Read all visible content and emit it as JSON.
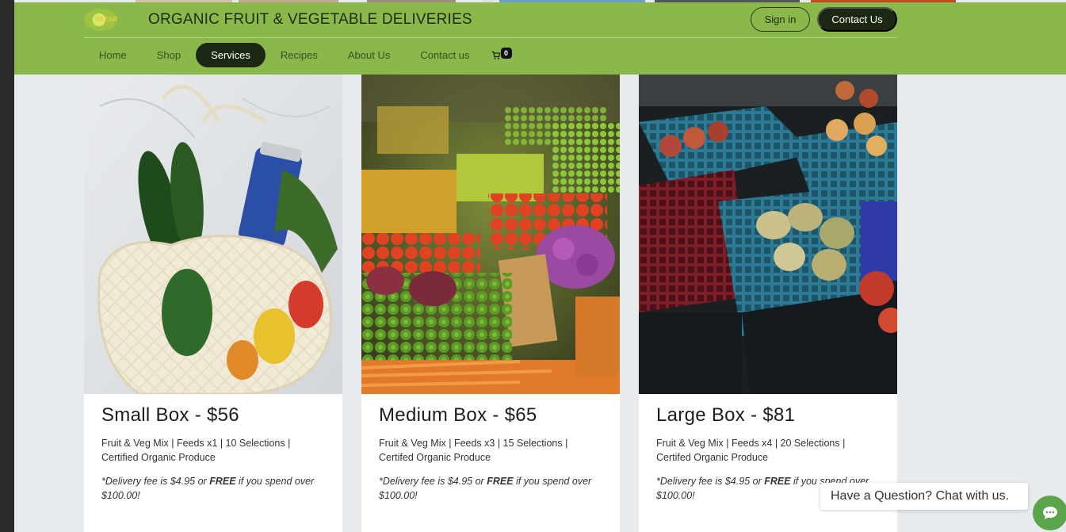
{
  "header": {
    "logo_text": "BAZAR",
    "site_title": "ORGANIC FRUIT & VEGETABLE DELIVERIES",
    "signin_label": "Sign in",
    "contact_label": "Contact Us"
  },
  "nav": {
    "items": [
      {
        "label": "Home"
      },
      {
        "label": "Shop"
      },
      {
        "label": "Services"
      },
      {
        "label": "Recipes"
      },
      {
        "label": "About Us"
      },
      {
        "label": "Contact us"
      }
    ],
    "active": "Services",
    "cart_count": "0"
  },
  "cards": [
    {
      "title": "Small Box - $56",
      "desc": "Fruit & Veg Mix | Feeds x1 | 10 Selections | Certified Organic Produce",
      "note_pre": "*Delivery fee is $4.95 or ",
      "note_bold": "FREE",
      "note_post": " if you spend over $100.00!"
    },
    {
      "title": "Medium Box - $65",
      "desc": "Fruit & Veg Mix | Feeds x3 | 15 Selections | Certifed Organic Produce",
      "note_pre": "*Delivery fee is $4.95 or ",
      "note_bold": "FREE",
      "note_post": " if you spend over $100.00!"
    },
    {
      "title": "Large Box - $81",
      "desc": "Fruit & Veg Mix | Feeds x4 | 20 Selections | Certifed Organic Produce",
      "note_pre": "*Delivery fee is $4.95 or ",
      "note_bold": "FREE",
      "note_post": " if you spend over $100.00!"
    }
  ],
  "chat": {
    "prompt": "Have a Question? Chat with us."
  },
  "colors": {
    "header_green": "#8ab84a",
    "dark_button": "#1d2814",
    "chat_green": "#5aa54a"
  },
  "icons": [
    "cart-icon",
    "chat-icon",
    "logo"
  ]
}
